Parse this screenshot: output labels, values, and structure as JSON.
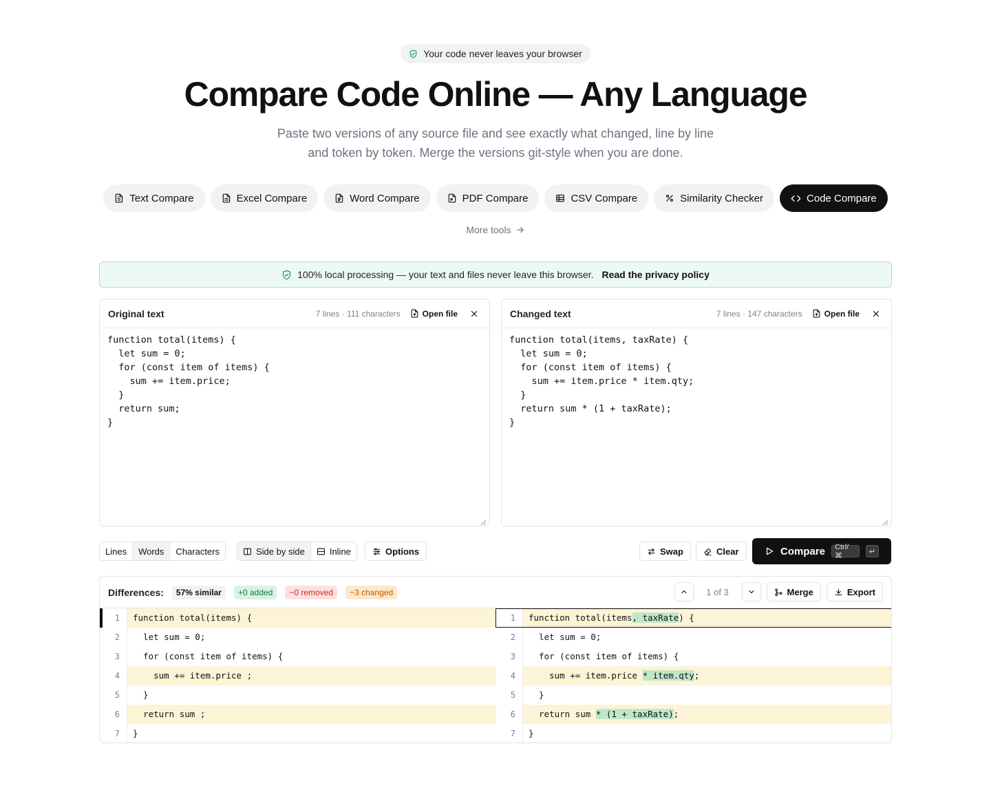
{
  "privacy_pill": "Your code never leaves your browser",
  "title": "Compare Code Online — Any Language",
  "subtitle": "Paste two versions of any source file and see exactly what changed, line by line and token by token. Merge the versions git-style when you are done.",
  "tools": [
    {
      "label": "Text Compare",
      "icon": "file-text-icon"
    },
    {
      "label": "Excel Compare",
      "icon": "file-spreadsheet-icon"
    },
    {
      "label": "Word Compare",
      "icon": "file-word-icon"
    },
    {
      "label": "PDF Compare",
      "icon": "file-pdf-icon"
    },
    {
      "label": "CSV Compare",
      "icon": "table-icon"
    },
    {
      "label": "Similarity Checker",
      "icon": "percent-icon"
    },
    {
      "label": "Code Compare",
      "icon": "code-icon",
      "active": true
    }
  ],
  "more_tools": "More tools",
  "banner": {
    "text": "100% local processing — your text and files never leave this browser.",
    "link": "Read the privacy policy"
  },
  "original": {
    "title": "Original text",
    "stats": "7 lines · 111 characters",
    "open_file": "Open file",
    "content": "function total(items) {\n  let sum = 0;\n  for (const item of items) {\n    sum += item.price;\n  }\n  return sum;\n}"
  },
  "changed": {
    "title": "Changed text",
    "stats": "7 lines · 147 characters",
    "open_file": "Open file",
    "content": "function total(items, taxRate) {\n  let sum = 0;\n  for (const item of items) {\n    sum += item.price * item.qty;\n  }\n  return sum * (1 + taxRate);\n}"
  },
  "toolbar": {
    "granularity": [
      "Lines",
      "Words",
      "Characters"
    ],
    "selected_granularity": "Words",
    "view_side": "Side by side",
    "view_inline": "Inline",
    "options": "Options",
    "swap": "Swap",
    "clear": "Clear",
    "compare": "Compare",
    "shortcut_mod": "Ctrl/⌘",
    "shortcut_key": "↵"
  },
  "diff": {
    "label": "Differences:",
    "similar": "57% similar",
    "added": "+0 added",
    "removed": "−0 removed",
    "changed": "~3 changed",
    "position": "1 of 3",
    "merge": "Merge",
    "export": "Export",
    "left_rows": [
      {
        "n": "1",
        "parts": [
          {
            "t": "function total(items) {"
          }
        ],
        "changed": true
      },
      {
        "n": "2",
        "parts": [
          {
            "t": "  let sum = 0;"
          }
        ]
      },
      {
        "n": "3",
        "parts": [
          {
            "t": "  for (const item of items) {"
          }
        ]
      },
      {
        "n": "4",
        "parts": [
          {
            "t": "    sum += item.price ;"
          }
        ],
        "changed": true
      },
      {
        "n": "5",
        "parts": [
          {
            "t": "  }"
          }
        ]
      },
      {
        "n": "6",
        "parts": [
          {
            "t": "  return sum ;"
          }
        ],
        "changed": true
      },
      {
        "n": "7",
        "parts": [
          {
            "t": "}"
          }
        ]
      }
    ],
    "right_rows": [
      {
        "n": "1",
        "parts": [
          {
            "t": "function total(items"
          },
          {
            "t": ", taxRate",
            "hl": true
          },
          {
            "t": ") {"
          }
        ],
        "changed": true
      },
      {
        "n": "2",
        "parts": [
          {
            "t": "  let sum = 0;"
          }
        ]
      },
      {
        "n": "3",
        "parts": [
          {
            "t": "  for (const item of items) {"
          }
        ]
      },
      {
        "n": "4",
        "parts": [
          {
            "t": "    sum += item.price "
          },
          {
            "t": "* item.qty",
            "hl": true
          },
          {
            "t": ";"
          }
        ],
        "changed": true
      },
      {
        "n": "5",
        "parts": [
          {
            "t": "  }"
          }
        ]
      },
      {
        "n": "6",
        "parts": [
          {
            "t": "  return sum "
          },
          {
            "t": "* (1 + taxRate)",
            "hl": true
          },
          {
            "t": ";"
          }
        ],
        "changed": true
      },
      {
        "n": "7",
        "parts": [
          {
            "t": "}"
          }
        ]
      }
    ]
  }
}
